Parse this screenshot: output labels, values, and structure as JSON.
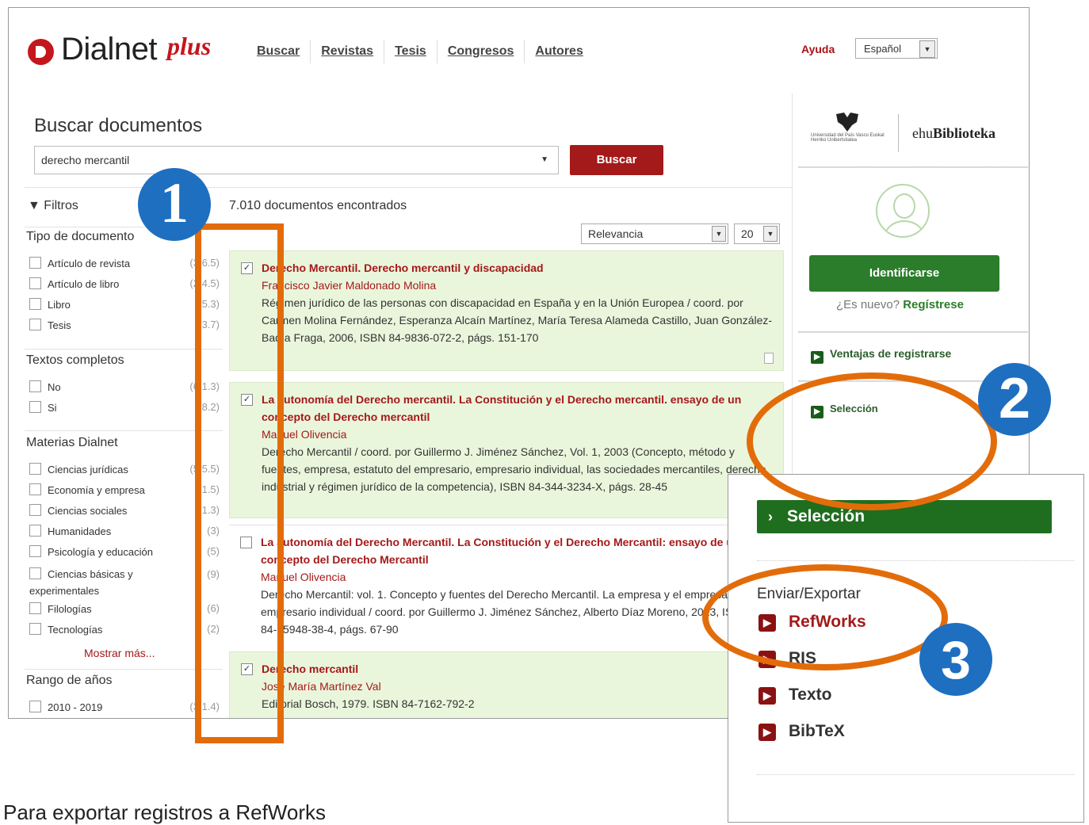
{
  "header": {
    "logo_text": "Dialnet",
    "logo_plus": "plus",
    "nav": [
      "Buscar",
      "Revistas",
      "Tesis",
      "Congresos",
      "Autores"
    ],
    "help": "Ayuda",
    "language": "Español"
  },
  "search": {
    "title": "Buscar documentos",
    "query": "derecho mercantil",
    "button": "Buscar"
  },
  "filters": {
    "label": "Filtros",
    "facets": [
      {
        "title": "Tipo de documento",
        "items": [
          {
            "label": "Artículo de revista",
            "count": "(3.6.5)"
          },
          {
            "label": "Artículo de libro",
            "count": "(2.4.5)"
          },
          {
            "label": "Libro",
            "count": "(5.3)"
          },
          {
            "label": "Tesis",
            "count": "(3.7)"
          }
        ]
      },
      {
        "title": "Textos completos",
        "items": [
          {
            "label": "No",
            "count": "(6.1.3)"
          },
          {
            "label": "Si",
            "count": "(8.2)"
          }
        ]
      },
      {
        "title": "Materias Dialnet",
        "items": [
          {
            "label": "Ciencias jurídicas",
            "count": "(5.5.5)"
          },
          {
            "label": "Economía y empresa",
            "count": "(1.5)"
          },
          {
            "label": "Ciencias sociales",
            "count": "(1.3)"
          },
          {
            "label": "Humanidades",
            "count": "(3)"
          },
          {
            "label": "Psicología y educación",
            "count": "(5)"
          },
          {
            "label": "Ciencias básicas y experimentales",
            "count": "(9)"
          },
          {
            "label": "Filologías",
            "count": "(6)"
          },
          {
            "label": "Tecnologías",
            "count": "(2)"
          }
        ]
      },
      {
        "title": "Rango de años",
        "items": [
          {
            "label": "2010 - 2019",
            "count": "(3.1.4)"
          }
        ]
      }
    ],
    "more": "Mostrar más..."
  },
  "results": {
    "count_text": "7.010 documentos encontrados",
    "sort": "Relevancia",
    "per_page": "20",
    "items": [
      {
        "checked": true,
        "title": "Derecho Mercantil. Derecho mercantil y discapacidad",
        "authors": "Francisco Javier Maldonado Molina",
        "body": "Régimen jurídico de las personas con discapacidad en España y en la Unión Europea / coord. por Carmen Molina Fernández, Esperanza Alcaín Martínez, María Teresa Alameda Castillo, Juan González-Badía Fraga, 2006, ISBN 84-9836-072-2, págs. 151-170"
      },
      {
        "checked": true,
        "title": "La autonomía del Derecho mercantil. La Constitución y el Derecho mercantil. ensayo de un concepto del Derecho mercantil",
        "authors": "Manuel Olivencia",
        "body": "Derecho Mercantil / coord. por Guillermo J. Jiménez Sánchez, Vol. 1, 2003 (Concepto, método y fuentes, empresa, estatuto del empresario, empresario individual, las sociedades mercantiles, derecho industrial y régimen jurídico de la competencia), ISBN 84-344-3234-X, págs. 28-45"
      },
      {
        "checked": false,
        "title": "La autonomía del Derecho Mercantil. La Constitución y el Derecho Mercantil: ensayo de un concepto del Derecho Mercantil",
        "authors": "Manuel Olivencia",
        "body": "Derecho Mercantil: vol. 1. Concepto y fuentes del Derecho Mercantil. La empresa y el empresario. El empresario individual / coord. por Guillermo J. Jiménez Sánchez, Alberto Díaz Moreno, 2013, ISBN 978-84-15948-38-4, págs. 67-90"
      },
      {
        "checked": true,
        "title": "Derecho mercantil",
        "authors": "José María Martínez Val",
        "body": "Editorial Bosch, 1979. ISBN 84-7162-792-2"
      }
    ]
  },
  "sidebar": {
    "library_small": "Universidad del País Vasco   Euskal Herriko Unibertsitatea",
    "library_prefix": "ehu",
    "library_name": "Biblioteka",
    "login": "Identificarse",
    "new_q": "¿Es nuevo?",
    "register": "Regístrese",
    "benefits": "Ventajas de registrarse",
    "selection": "Selección"
  },
  "zoom": {
    "selection": "Selección",
    "export_heading": "Enviar/Exportar",
    "items": [
      "RefWorks",
      "RIS",
      "Texto",
      "BibTeX"
    ]
  },
  "annotations": {
    "one": "1",
    "two": "2",
    "three": "3",
    "color": "#e36c0a",
    "bubble_color": "#1e6fc0"
  },
  "footer": "Para exportar registros a RefWorks"
}
